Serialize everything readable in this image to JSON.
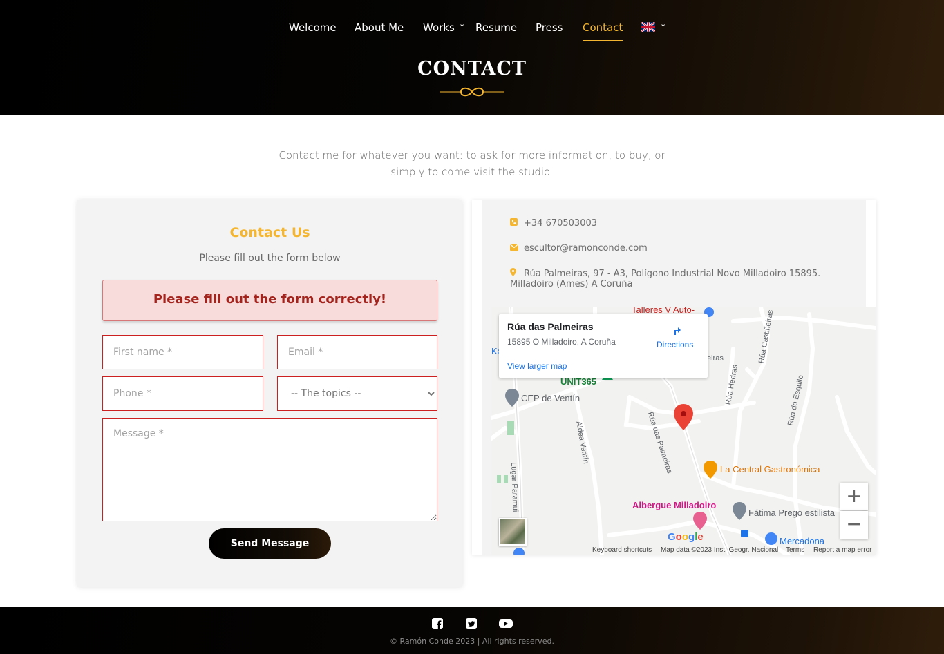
{
  "nav": {
    "items": [
      "Welcome",
      "About Me",
      "Works",
      "Resume",
      "Press",
      "Contact"
    ],
    "active": "Contact",
    "language_flag": "uk-flag-icon"
  },
  "header": {
    "title": "CONTACT"
  },
  "intro": "Contact me for whatever you want: to ask for more information, to buy, or simply to come visit the studio.",
  "form": {
    "heading": "Contact Us",
    "subheading": "Please fill out the form below",
    "alert": "Please fill out the form correctly!",
    "first_name_placeholder": "First name *",
    "email_placeholder": "Email *",
    "phone_placeholder": "Phone *",
    "topics_selected": "-- The topics --",
    "message_placeholder": "Message *",
    "submit_label": "Send Message"
  },
  "info": {
    "phone": "+34 670503003",
    "email": "escultor@ramonconde.com",
    "address": "Rúa Palmeiras, 97 - A3, Polígono Industrial Novo Milladoiro 15895. Milladoiro (Ames) A Coruña"
  },
  "map": {
    "place_title": "Rúa das Palmeiras",
    "place_address": "15895 O Milladoiro, A Coruña",
    "directions_label": "Directions",
    "larger_map_label": "View larger map",
    "labels": {
      "talleres": "Talleres V Auto-",
      "unit365": "UNIT365",
      "cep": "CEP de Ventín",
      "central": "La Central Gastronómica",
      "albergue": "Albergue Milladoiro",
      "fatima": "Fátima Prego estilista",
      "mercadona": "Mercadona",
      "rua_palmeiras": "Rúa das Palmeiras",
      "rua_hedras": "Rúa Hedras",
      "rua_castineiras": "Rúa Castiñeiras",
      "rua_esquilo": "Rúa do Esquilo",
      "aldea_ventin": "Aldea Ventín",
      "lugar_paramui": "Lugar Paramui",
      "fragment_k": "Ka",
      "fragment_eiras": "eiras"
    },
    "zoom_in": "+",
    "zoom_out": "−",
    "google": "Google",
    "keyboard_shortcuts": "Keyboard shortcuts",
    "map_data": "Map data ©2023 Inst. Geogr. Nacional",
    "terms": "Terms",
    "report": "Report a map error"
  },
  "footer": {
    "social": [
      "facebook-icon",
      "twitter-icon",
      "youtube-icon"
    ],
    "copyright": "© Ramón Conde 2023 | All rights reserved."
  },
  "colors": {
    "accent": "#f4b630",
    "error_border": "#cc1f1f",
    "alert_bg": "#f8dcdc",
    "alert_text": "#a3241d"
  }
}
